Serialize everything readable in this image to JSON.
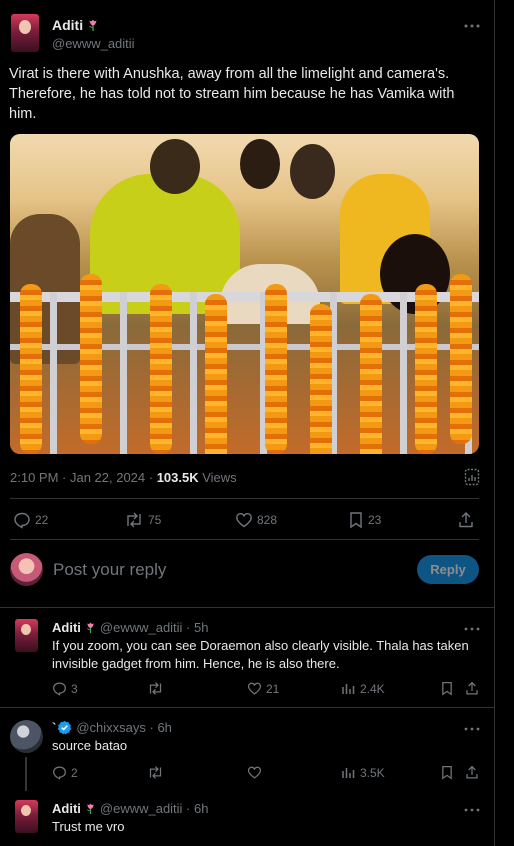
{
  "main_tweet": {
    "author_name": "Aditi",
    "author_handle": "@ewww_aditii",
    "text": "Virat is there with Anushka, away from all the limelight and camera's. Therefore, he has told not to stream him because he has Vamika with him.",
    "timestamp": "2:10 PM · Jan 22, 2024 · ",
    "views_count": "103.5K",
    "views_label": " Views",
    "replies": "22",
    "reposts": "75",
    "likes": "828",
    "bookmarks": "23"
  },
  "reply_box": {
    "placeholder": "Post your reply",
    "button_label": "Reply"
  },
  "replies": [
    {
      "name": "Aditi",
      "handle": "@ewww_aditii · 5h",
      "text": "If you zoom, you can see Doraemon also clearly visible. Thala has taken invisible gadget from him. Hence, he is also there.",
      "reply_count": "3",
      "repost_count": "",
      "like_count": "21",
      "view_count": "2.4K"
    },
    {
      "name": "`",
      "handle": "@chixxsays · 6h",
      "text": "source batao",
      "reply_count": "2",
      "repost_count": "",
      "like_count": "",
      "view_count": "3.5K"
    },
    {
      "name": "Aditi",
      "handle": "@ewww_aditii · 6h",
      "text": "Trust me vro"
    }
  ],
  "colors": {
    "background": "#000000",
    "text": "#e7e9ea",
    "muted": "#71767b",
    "border": "#2f3336",
    "accent": "#1d9bf0"
  },
  "icons": [
    "flower-emoji-icon",
    "more-icon",
    "analytics-icon",
    "reply-icon",
    "repost-icon",
    "like-icon",
    "bookmark-icon",
    "share-icon",
    "views-icon",
    "verified-icon"
  ]
}
